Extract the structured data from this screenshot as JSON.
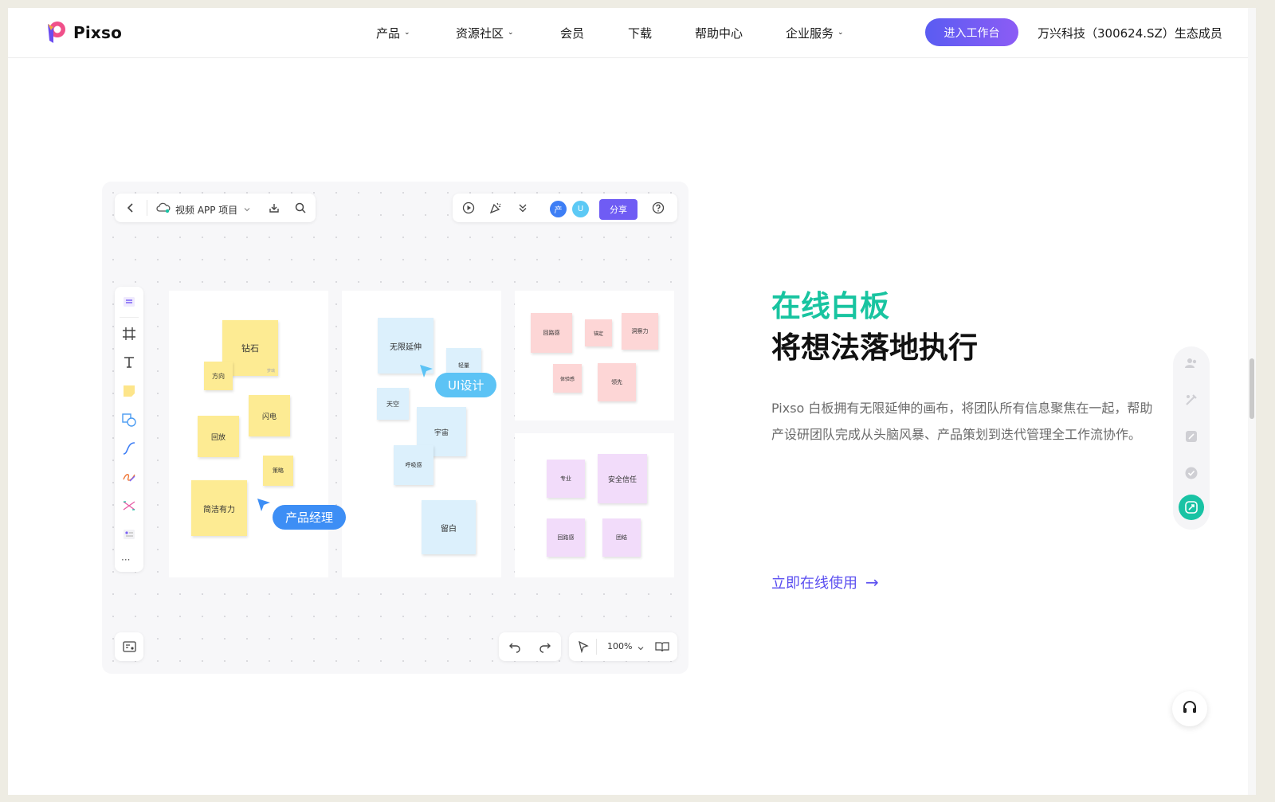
{
  "nav": {
    "logo_text": "Pixso",
    "items": [
      {
        "label": "产品",
        "dropdown": true
      },
      {
        "label": "资源社区",
        "dropdown": true
      },
      {
        "label": "会员",
        "dropdown": false
      },
      {
        "label": "下载",
        "dropdown": false
      },
      {
        "label": "帮助中心",
        "dropdown": false
      },
      {
        "label": "企业服务",
        "dropdown": true
      }
    ],
    "cta_label": "进入工作台",
    "member_text": "万兴科技（300624.SZ）生态成员",
    "chevron": "⌄"
  },
  "hero": {
    "accent_title": "在线白板",
    "title": "将想法落地执行",
    "description": "Pixso 白板拥有无限延伸的画布，将团队所有信息聚焦在一起，帮助产设研团队完成从头脑风暴、产品策划到迭代管理全工作流协作。",
    "link_label": "立即在线使用",
    "link_arrow": "→"
  },
  "board": {
    "project_name": "视频 APP 项目",
    "share_label": "分享",
    "avatars": [
      {
        "text": "产",
        "color": "#3d7ef5"
      },
      {
        "text": "U",
        "color": "#5cc9f5"
      }
    ],
    "zoom": "100%",
    "notes_yellow": [
      "钻石",
      "方向",
      "闪电",
      "回放",
      "简洁有力",
      "策略"
    ],
    "notes_blue": [
      "无限延伸",
      "轻量",
      "天空",
      "宇宙",
      "呼吸感",
      "留白"
    ],
    "notes_pink": [
      "回路感",
      "锚定",
      "洞察力",
      "体验感",
      "领先"
    ],
    "notes_violet": [
      "专业",
      "安全信任",
      "回路感",
      "团结"
    ],
    "cursors": [
      {
        "label": "产品经理",
        "color": "#3d8ef5"
      },
      {
        "label": "UI设计",
        "color": "#5cc3f5"
      }
    ],
    "more": "···"
  },
  "colors": {
    "accent": "#18c4a0",
    "brand": "#5b4ff0"
  }
}
